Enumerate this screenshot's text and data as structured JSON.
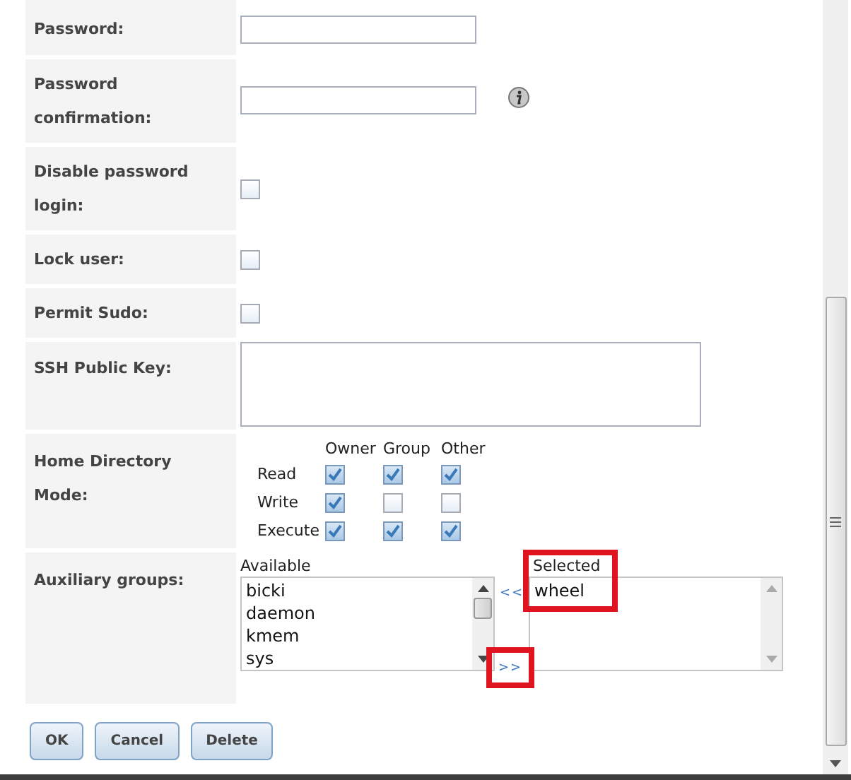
{
  "fields": [
    {
      "kind": "password",
      "label": "Password:",
      "info": false
    },
    {
      "kind": "password",
      "label": "Password confirmation:",
      "info": true
    },
    {
      "kind": "checkbox",
      "label": "Disable password login:",
      "checked": false
    },
    {
      "kind": "checkbox",
      "label": "Lock user:",
      "checked": false
    },
    {
      "kind": "checkbox",
      "label": "Permit Sudo:",
      "checked": false
    },
    {
      "kind": "textarea",
      "label": "SSH Public Key:"
    },
    {
      "kind": "mode",
      "label": "Home Directory Mode:",
      "columns": [
        "Owner",
        "Group",
        "Other"
      ],
      "rows": [
        {
          "label": "Read",
          "checks": [
            {
              "checked": true
            },
            {
              "checked": true
            },
            {
              "checked": true
            }
          ]
        },
        {
          "label": "Write",
          "checks": [
            {
              "checked": true
            },
            {
              "checked": false
            },
            {
              "checked": false
            }
          ]
        },
        {
          "label": "Execute",
          "checks": [
            {
              "checked": true
            },
            {
              "checked": true
            },
            {
              "checked": true
            }
          ]
        }
      ]
    },
    {
      "kind": "groups",
      "label": "Auxiliary groups:",
      "available_label": "Available",
      "available": [
        "bicki",
        "daemon",
        "kmem",
        "sys"
      ],
      "remove_button": "<<",
      "add_button": ">>",
      "selected_label": "Selected",
      "selected": [
        "wheel"
      ]
    }
  ],
  "buttons": [
    "OK",
    "Cancel",
    "Delete"
  ]
}
